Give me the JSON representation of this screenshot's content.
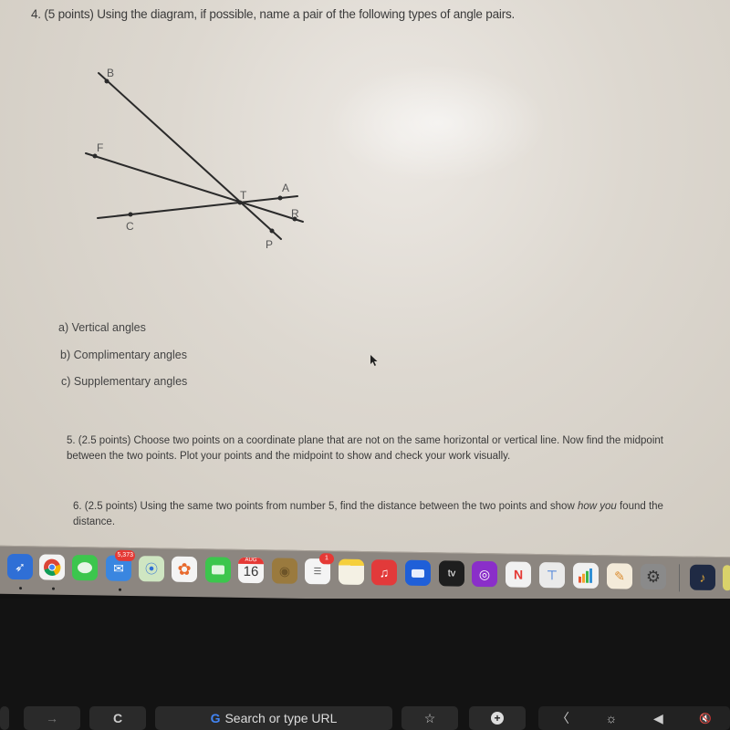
{
  "document": {
    "question4": {
      "title": "4. (5 points) Using the diagram, if possible, name a pair of the following types of angle pairs.",
      "diagram_labels": {
        "B": "B",
        "F": "F",
        "T": "T",
        "A": "A",
        "R": "R",
        "C": "C",
        "P": "P"
      },
      "options": [
        "a) Vertical angles",
        "b) Complimentary angles",
        "c) Supplementary angles"
      ]
    },
    "question5": {
      "text": "5. (2.5 points) Choose two points on a coordinate plane that are not on the same horizontal or vertical line.  Now find the midpoint between the two points. Plot your points and the midpoint to show and check your work visually."
    },
    "question6": {
      "text_before_italic": "6. (2.5 points) Using the same two points from number 5, find the distance between the two points and show ",
      "text_italic": "how you",
      "text_after_italic": " found the distance."
    }
  },
  "dock": {
    "apps": [
      {
        "name": "Safari",
        "icon": "compass-icon"
      },
      {
        "name": "Chrome",
        "icon": "chrome-icon"
      },
      {
        "name": "Messages",
        "icon": "message-bubble-icon"
      },
      {
        "name": "Mail",
        "icon": "envelope-icon",
        "badge": "5,373"
      },
      {
        "name": "Maps",
        "icon": "map-icon"
      },
      {
        "name": "Photos",
        "icon": "flower-icon"
      },
      {
        "name": "FaceTime",
        "icon": "video-camera-icon"
      },
      {
        "name": "Calendar",
        "icon": "calendar-icon",
        "month": "AUG",
        "day": "16"
      },
      {
        "name": "Contacts",
        "icon": "contacts-icon"
      },
      {
        "name": "Reminders",
        "icon": "checklist-icon",
        "badge": "1"
      },
      {
        "name": "Notes",
        "icon": "notes-icon"
      },
      {
        "name": "Music",
        "icon": "music-note-icon",
        "glyph": "♫"
      },
      {
        "name": "Zoom",
        "icon": "zoom-video-icon"
      },
      {
        "name": "TV",
        "icon": "apple-tv-icon",
        "label": "tv"
      },
      {
        "name": "Podcasts",
        "icon": "podcast-icon"
      },
      {
        "name": "News",
        "icon": "news-icon"
      },
      {
        "name": "Keynote",
        "icon": "keynote-icon"
      },
      {
        "name": "Numbers",
        "icon": "bar-chart-icon"
      },
      {
        "name": "Pages",
        "icon": "pen-icon"
      },
      {
        "name": "System Preferences",
        "icon": "gear-icon"
      },
      {
        "name": "GarageBand",
        "icon": "guitar-icon"
      }
    ]
  },
  "touchbar": {
    "forward_icon": "→",
    "reload_icon": "C",
    "search_placeholder": "Search or type URL",
    "google_glyph": "G",
    "bookmark_icon": "☆",
    "new_tab_icon": "+",
    "collapse_icon": "〈",
    "brightness_icon": "☼",
    "volume_icon": "◀",
    "mute_icon": "🔇"
  }
}
